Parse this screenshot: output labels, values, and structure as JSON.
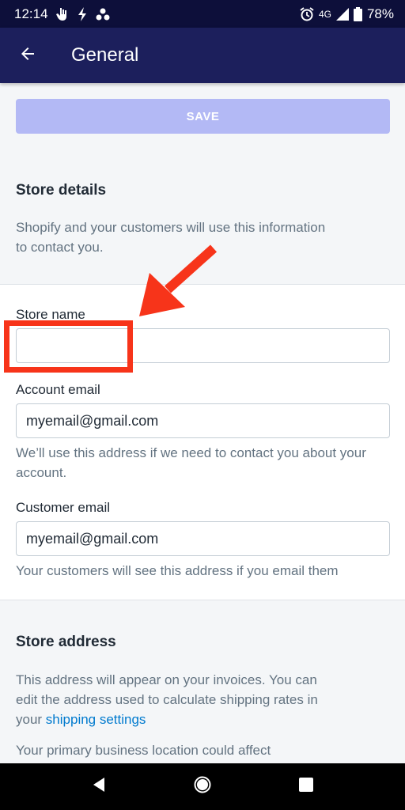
{
  "status_bar": {
    "time": "12:14",
    "network": "4G",
    "battery": "78%",
    "icons": [
      "hand-icon",
      "flash-icon",
      "dots-icon",
      "alarm-icon",
      "signal-icon",
      "battery-icon"
    ]
  },
  "app_bar": {
    "title": "General",
    "back_icon": "back-arrow-icon"
  },
  "save_label": "SAVE",
  "store_details": {
    "title": "Store details",
    "description": "Shopify and your customers will use this information to contact you.",
    "store_name": {
      "label": "Store name",
      "value": ""
    },
    "account_email": {
      "label": "Account email",
      "value": "myemail@gmail.com",
      "help": "We’ll use this address if we need to contact you about your account."
    },
    "customer_email": {
      "label": "Customer email",
      "value": "myemail@gmail.com",
      "help": "Your customers will see this address if you email them"
    }
  },
  "store_address": {
    "title": "Store address",
    "description_prefix": "This address will appear on your invoices. You can edit the address used to calculate shipping rates in your ",
    "link_text": "shipping settings",
    "note": "Your primary business location could affect"
  },
  "nav_bar": {
    "icons": [
      "nav-back-icon",
      "nav-home-icon",
      "nav-recents-icon"
    ]
  },
  "colors": {
    "app_bar": "#1c1f5c",
    "status_bar": "#0d0f3a",
    "save_button": "#b3b9f5",
    "annotation": "#f7341a",
    "link": "#007ace"
  }
}
